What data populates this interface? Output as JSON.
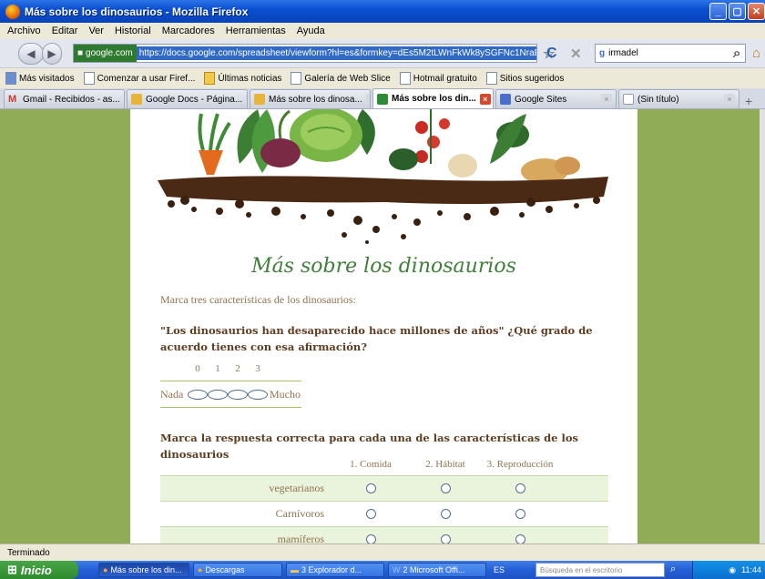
{
  "window": {
    "title": "Más sobre los dinosaurios - Mozilla Firefox"
  },
  "menu": [
    "Archivo",
    "Editar",
    "Ver",
    "Historial",
    "Marcadores",
    "Herramientas",
    "Ayuda"
  ],
  "nav": {
    "site": "google.com",
    "url": "https://docs.google.com/spreadsheet/viewform?hl=es&formkey=dEs5M2tLWnFkWk8ySGFNc1NraE1n",
    "search_value": "irmadel"
  },
  "bookmarks": [
    "Más visitados",
    "Comenzar a usar Firef...",
    "Últimas noticias",
    "Galería de Web Slice",
    "Hotmail gratuito",
    "Sitios sugeridos"
  ],
  "tabs": [
    {
      "label": "Gmail - Recibidos - as...",
      "icon": "gmail-icon",
      "color": "#c4392a"
    },
    {
      "label": "Google Docs - Página...",
      "icon": "docs-icon",
      "color": "#e8b43a"
    },
    {
      "label": "Más sobre los dinosa...",
      "icon": "docs-icon",
      "color": "#e8b43a"
    },
    {
      "label": "Más sobre los din...",
      "icon": "form-icon",
      "color": "#2e8b3a",
      "active": true
    },
    {
      "label": "Google Sites",
      "icon": "sites-icon",
      "color": "#4a6fcf"
    },
    {
      "label": "(Sin título)",
      "icon": "page-icon",
      "color": "#ffffff"
    }
  ],
  "form": {
    "title": "Más sobre los dinosaurios",
    "description": "Marca tres características de los dinosaurios:",
    "q1": {
      "title": "\"Los dinosaurios han desaparecido hace millones de años\" ¿Qué grado de acuerdo tienes con esa afirmación?",
      "scale": [
        "0",
        "1",
        "2",
        "3"
      ],
      "min_label": "Nada",
      "max_label": "Mucho"
    },
    "q2": {
      "title": "Marca la respuesta correcta para cada una de las características de los dinosaurios",
      "columns": [
        "1. Comida",
        "2. Hábitat",
        "3. Reproducción"
      ],
      "rows": [
        "vegetarianos",
        "Carnívoros",
        "mamíferos"
      ]
    }
  },
  "status": "Terminado",
  "taskbar": {
    "start": "Inicio",
    "items": [
      "Más sobre los din...",
      "Descargas",
      "3 Explorador d...",
      "2 Microsoft Offi..."
    ],
    "lang": "ES",
    "search_placeholder": "Búsqueda en el escritorio",
    "time": "11:44"
  },
  "colors": {
    "background": "#91ac57",
    "title": "#3f7f3a",
    "question": "#5e3d21",
    "text": "#8f7350"
  }
}
